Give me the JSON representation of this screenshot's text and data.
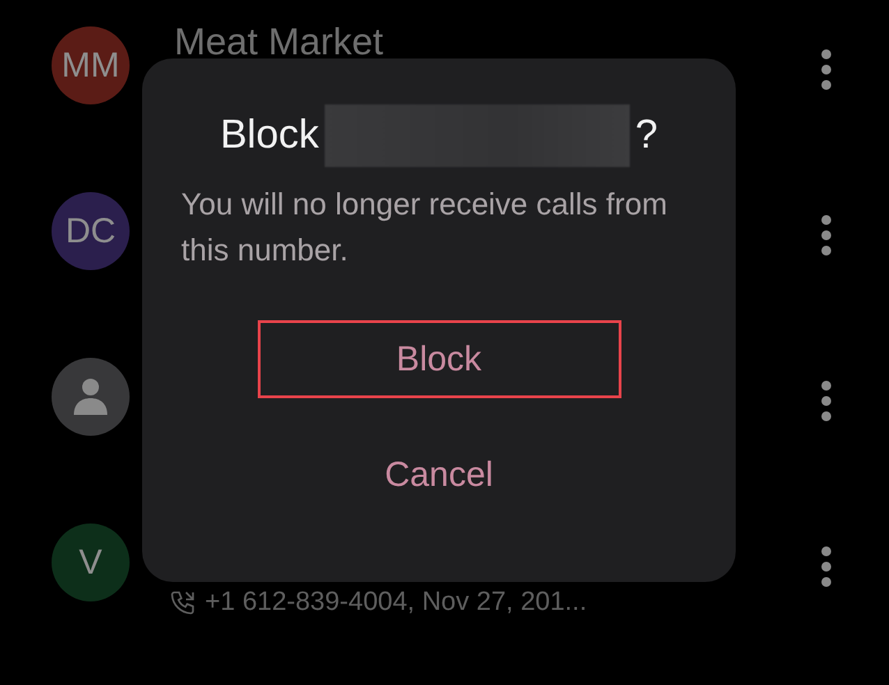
{
  "contacts": [
    {
      "avatar": {
        "kind": "initials",
        "text": "MM",
        "color": "#5b1c16"
      },
      "name": "Meat Market"
    },
    {
      "avatar": {
        "kind": "initials",
        "text": "DC",
        "color": "#2b1f4d"
      }
    },
    {
      "avatar": {
        "kind": "person",
        "color": "#38383a"
      }
    },
    {
      "avatar": {
        "kind": "initials",
        "text": "V",
        "color": "#0d2f1a"
      },
      "subtitle": "+1 612-839-4004, Nov 27, 201..."
    }
  ],
  "dialog": {
    "title_prefix": "Block",
    "title_suffix": "?",
    "message": "You will no longer receive calls from this number.",
    "actions": [
      {
        "label": "Block",
        "highlighted": true
      },
      {
        "label": "Cancel",
        "highlighted": false
      }
    ]
  }
}
